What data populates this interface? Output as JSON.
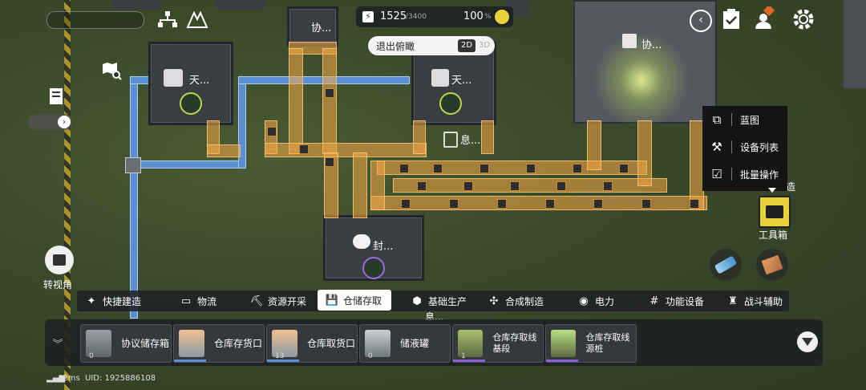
{
  "hud": {
    "power_current": "1525",
    "power_max": "/3400",
    "percent": "100",
    "percent_unit": "%"
  },
  "view_toggle": {
    "exit_label": "退出俯瞰",
    "mode_2d": "2D",
    "mode_3d": "3D"
  },
  "map_labels": {
    "protocol_top": "协...",
    "protocol_right": "协...",
    "sky_left": "天...",
    "sky_right": "天...",
    "rest": "息...",
    "seal": "封...",
    "rest_bottom": "息...",
    "partial_right": "造"
  },
  "left_controls": {
    "rotate_view_label": "转视角"
  },
  "context_menu": {
    "items": [
      {
        "icon": "blueprint-icon",
        "label": "蓝图"
      },
      {
        "icon": "device-list-icon",
        "label": "设备列表"
      },
      {
        "icon": "batch-icon",
        "label": "批量操作"
      }
    ]
  },
  "toolbox": {
    "label": "工具箱"
  },
  "category_tabs": [
    {
      "icon": "quick-build-icon",
      "label": "快捷建造"
    },
    {
      "icon": "logistics-icon",
      "label": "物流"
    },
    {
      "icon": "resource-icon",
      "label": "资源开采"
    },
    {
      "icon": "storage-icon",
      "label": "仓储存取"
    },
    {
      "icon": "basic-production-icon",
      "label": "基础生产"
    },
    {
      "icon": "synthesis-icon",
      "label": "合成制造"
    },
    {
      "icon": "power-icon",
      "label": "电力"
    },
    {
      "icon": "function-icon",
      "label": "功能设备"
    },
    {
      "icon": "combat-icon",
      "label": "战斗辅助"
    }
  ],
  "build_slots": [
    {
      "name": "协议储存箱",
      "count": "0",
      "bar": ""
    },
    {
      "name": "仓库存货口",
      "count": "",
      "bar": "#5b8fd0"
    },
    {
      "name": "仓库取货口",
      "count": "13",
      "bar": "#5b8fd0"
    },
    {
      "name": "储液罐",
      "count": "0",
      "bar": ""
    },
    {
      "name": "仓库存取线基段",
      "count": "1",
      "bar": "#8a5fd0"
    },
    {
      "name": "仓库存取线源桩",
      "count": "",
      "bar": "#8a5fd0"
    }
  ],
  "status": {
    "ping": "42ms",
    "uid": "UID: 1925886108"
  },
  "colors": {
    "belt": "#f5aa46",
    "pipe": "#5b8fd0",
    "accent_yellow": "#e8d23a",
    "selected_tab_bg": "#ffffff"
  }
}
